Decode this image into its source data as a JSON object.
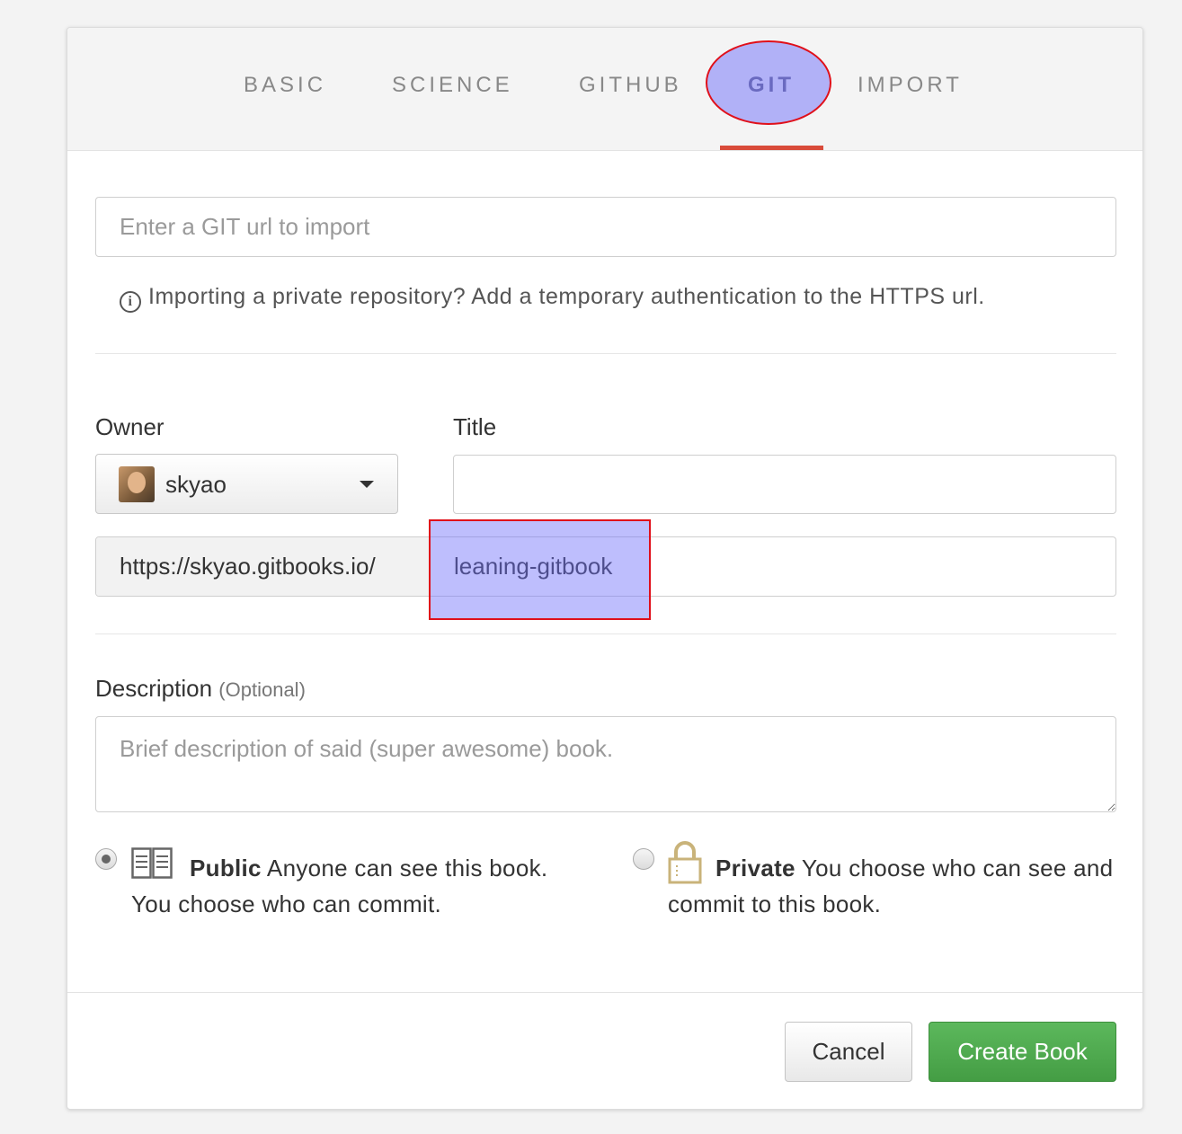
{
  "tabs": [
    {
      "label": "BASIC",
      "active": false
    },
    {
      "label": "SCIENCE",
      "active": false
    },
    {
      "label": "GITHUB",
      "active": false
    },
    {
      "label": "GIT",
      "active": true
    },
    {
      "label": "IMPORT",
      "active": false
    }
  ],
  "git_url": {
    "value": "",
    "placeholder": "Enter a GIT url to import"
  },
  "hint": {
    "icon": "info-icon",
    "text": "Importing a private repository? Add a temporary authentication to the HTTPS url."
  },
  "owner": {
    "label": "Owner",
    "selected": "skyao",
    "avatar": "user-avatar"
  },
  "title": {
    "label": "Title",
    "value": ""
  },
  "book_url": {
    "prefix": "https://skyao.gitbooks.io/",
    "slug": "leaning-gitbook"
  },
  "description": {
    "label": "Description",
    "optional": "(Optional)",
    "value": "",
    "placeholder": "Brief description of said (super awesome) book."
  },
  "visibility": {
    "public": {
      "title": "Public",
      "text": "Anyone can see this book. You choose who can commit.",
      "checked": true,
      "icon": "book-icon"
    },
    "private": {
      "title": "Private",
      "text": "You choose who can see and commit to this book.",
      "checked": false,
      "icon": "lock-icon"
    }
  },
  "buttons": {
    "cancel": "Cancel",
    "create": "Create Book"
  },
  "colors": {
    "accent_underline": "#d94b3a",
    "create_button": "#5cb85c",
    "annotation_border": "#e0101a",
    "annotation_fill": "#6e6efa"
  }
}
